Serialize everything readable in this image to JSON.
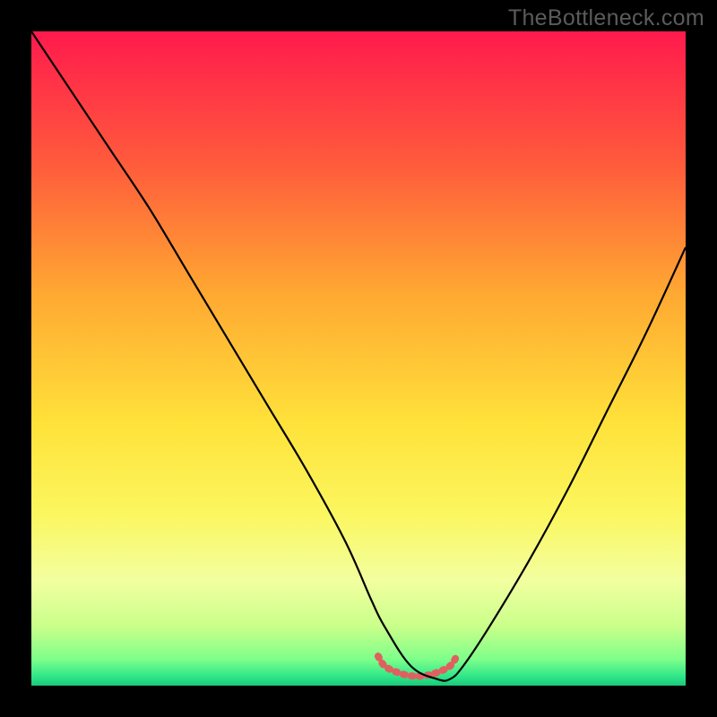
{
  "watermark": "TheBottleneck.com",
  "chart_data": {
    "type": "line",
    "title": "",
    "xlabel": "",
    "ylabel": "",
    "x_range": [
      0,
      100
    ],
    "y_range": [
      0,
      100
    ],
    "grid": false,
    "series": [
      {
        "name": "curve",
        "x": [
          0,
          6,
          12,
          18,
          24,
          30,
          36,
          42,
          48,
          52,
          54,
          58,
          62,
          64,
          66,
          70,
          76,
          82,
          88,
          94,
          100
        ],
        "y": [
          100,
          91,
          82,
          73,
          63,
          53,
          43,
          33,
          22,
          13,
          9,
          3,
          1,
          1,
          3,
          9,
          19,
          30,
          42,
          54,
          67
        ]
      },
      {
        "name": "tick-marks",
        "x": [
          53,
          54,
          56,
          58,
          60,
          62,
          64,
          65
        ],
        "y": [
          4.5,
          3.0,
          2.0,
          1.5,
          1.5,
          2.0,
          3.0,
          4.5
        ]
      }
    ],
    "background_gradient": {
      "stops": [
        {
          "offset": 0.0,
          "color": "#ff1a4d"
        },
        {
          "offset": 0.2,
          "color": "#ff5a3c"
        },
        {
          "offset": 0.4,
          "color": "#ffa832"
        },
        {
          "offset": 0.6,
          "color": "#ffe23a"
        },
        {
          "offset": 0.74,
          "color": "#fbf760"
        },
        {
          "offset": 0.84,
          "color": "#f2ffa0"
        },
        {
          "offset": 0.91,
          "color": "#c9ff8a"
        },
        {
          "offset": 0.96,
          "color": "#7dff8a"
        },
        {
          "offset": 0.985,
          "color": "#32e78a"
        },
        {
          "offset": 1.0,
          "color": "#18c97a"
        }
      ]
    },
    "curve_style": {
      "stroke": "#000000",
      "width": 2.2
    },
    "tick_style": {
      "stroke": "#e06060",
      "width": 8,
      "dash": "2 7"
    }
  }
}
